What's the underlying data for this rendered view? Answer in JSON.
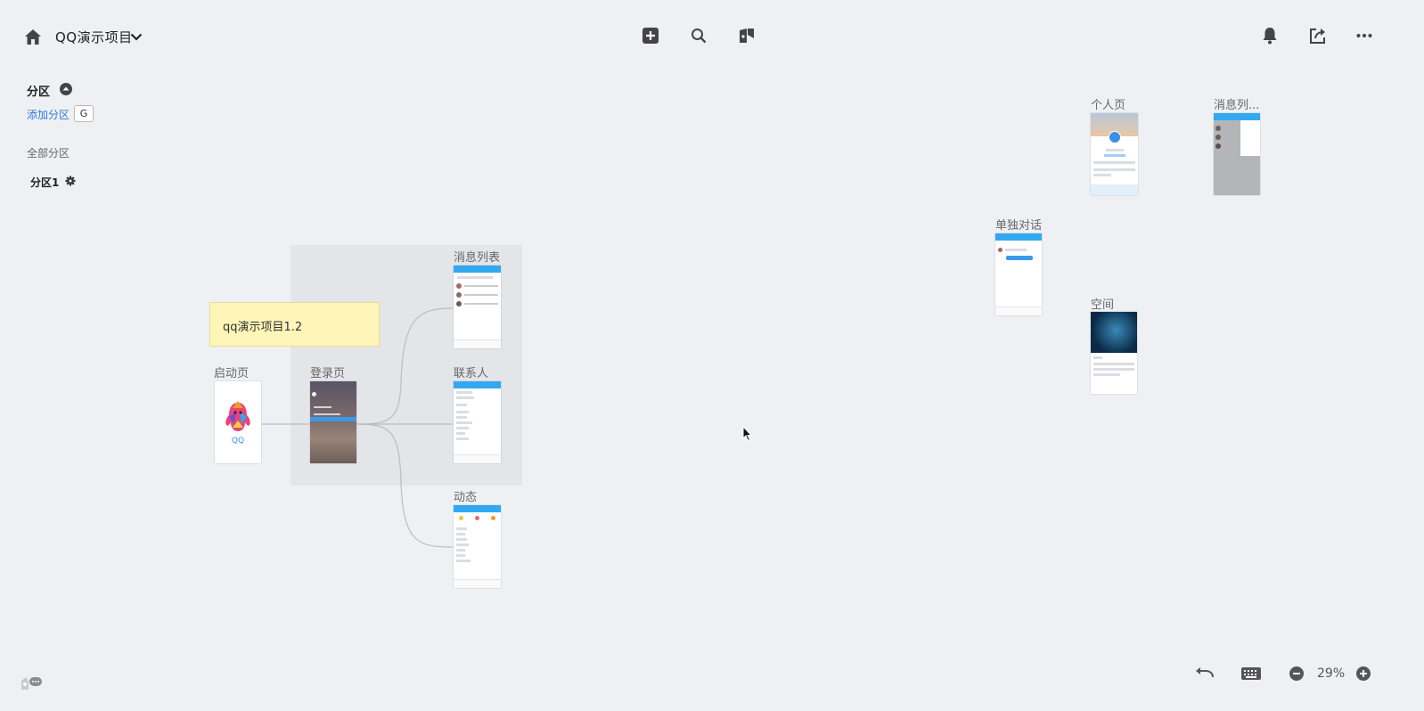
{
  "header": {
    "project_title": "QQ演示项目",
    "icons": [
      "home-icon",
      "chevron-down-icon",
      "add-icon",
      "search-icon",
      "bookmark-icon",
      "bell-icon",
      "share-icon",
      "more-icon"
    ]
  },
  "sidebar": {
    "section_title": "分区",
    "add_section_label": "添加分区",
    "add_section_shortcut": "G",
    "all_sections_label": "全部分区",
    "sections": [
      {
        "label": "分区1"
      }
    ]
  },
  "canvas": {
    "note_text": "qq演示项目1.2",
    "frames": [
      {
        "label": "启动页",
        "logo_text": "QQ"
      },
      {
        "label": "登录页"
      },
      {
        "label": "消息列表"
      },
      {
        "label": "联系人"
      },
      {
        "label": "动态"
      },
      {
        "label": "个人页"
      },
      {
        "label": "消息列..."
      },
      {
        "label": "单独对话"
      },
      {
        "label": "空间"
      }
    ]
  },
  "footer": {
    "zoom": "29%",
    "icons": [
      "undo-icon",
      "keyboard-icon",
      "zoom-out-icon",
      "zoom-in-icon",
      "feedback-icon"
    ]
  },
  "colors": {
    "background": "#eef0f4",
    "accent_blue": "#2d7bd6",
    "note_yellow": "#fff5b8",
    "phone_header_blue": "#32a8f0"
  }
}
